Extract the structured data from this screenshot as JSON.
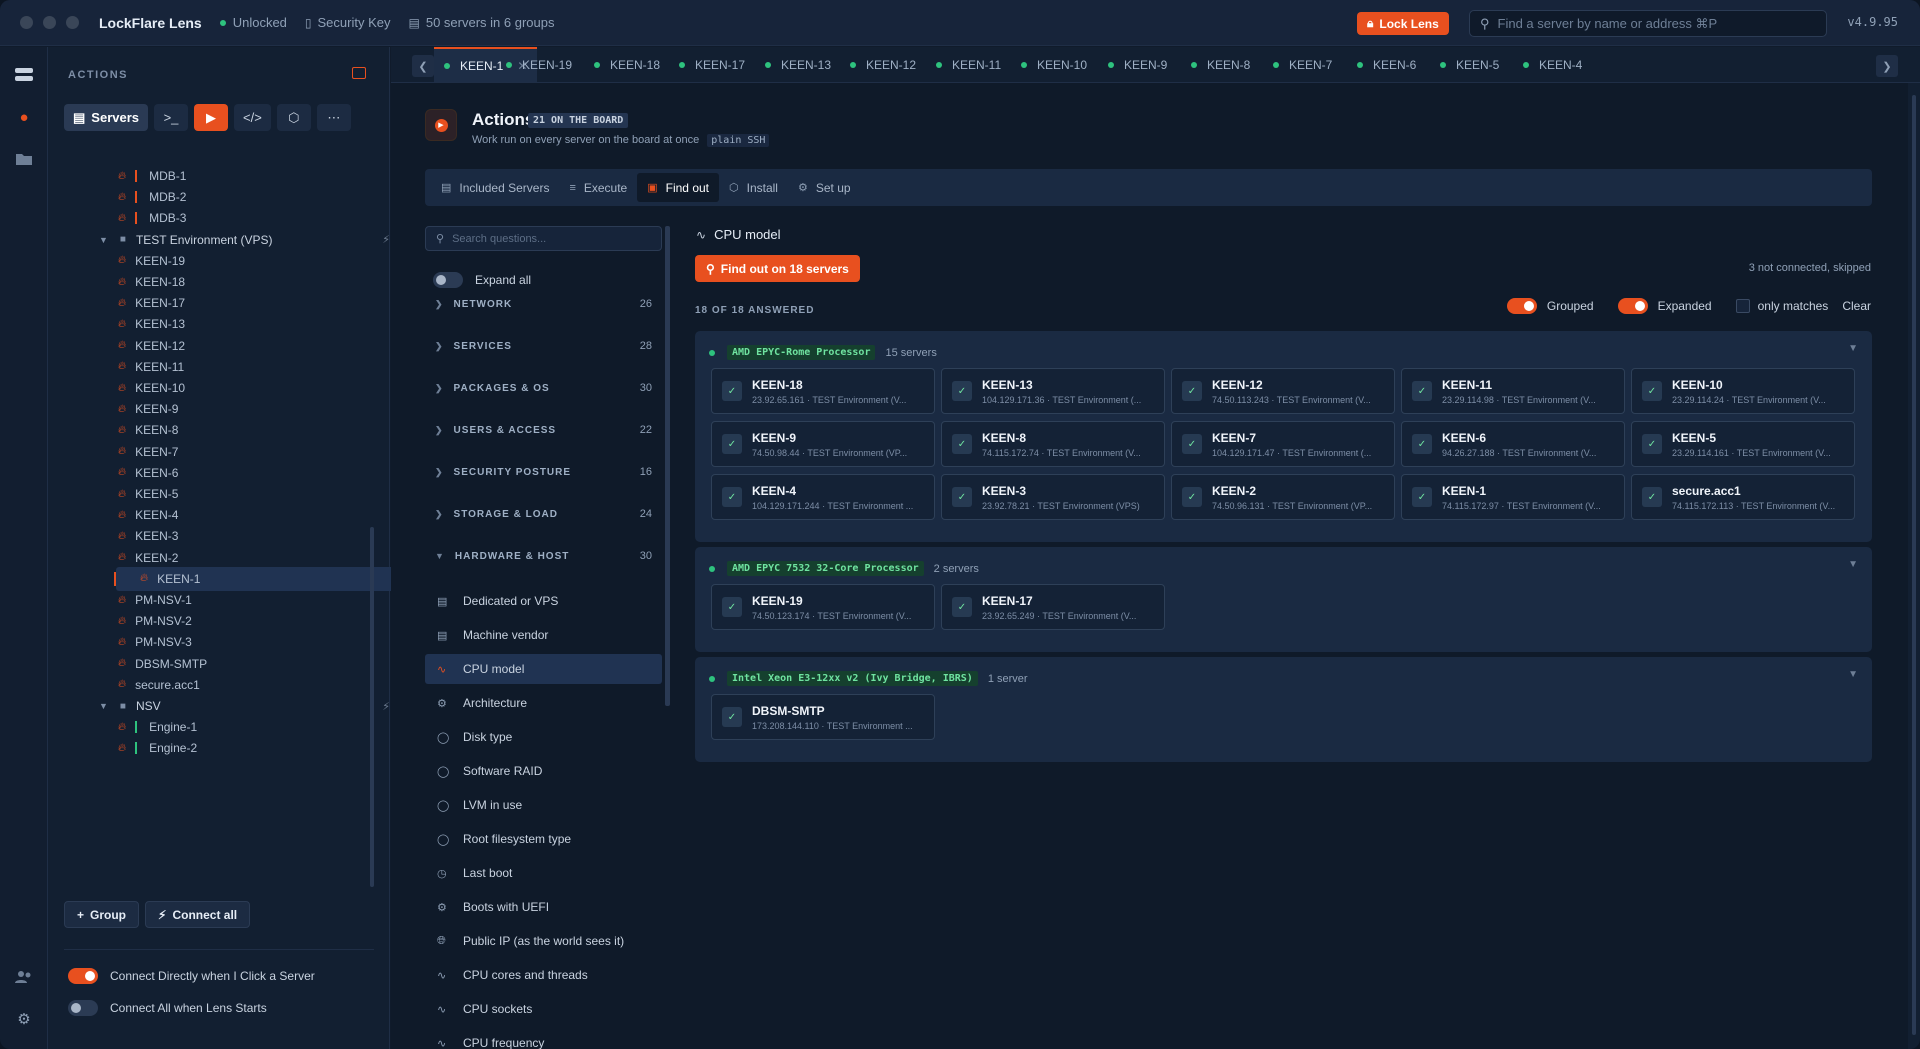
{
  "app": {
    "name": "LockFlare Lens",
    "status": "Unlocked",
    "security_key": "Security Key",
    "servers_summary": "50 servers in 6 groups",
    "lock_button": "Lock Lens",
    "search_placeholder": "Find a server by name or address  ⌘P",
    "version": "v4.9.95"
  },
  "sidebar": {
    "title": "ACTIONS",
    "servers_tab": "Servers",
    "rows": [
      {
        "label": "MDB-1",
        "kind": "server",
        "bar": "orange",
        "status": "grey"
      },
      {
        "label": "MDB-2",
        "kind": "server",
        "bar": "orange",
        "status": "grey"
      },
      {
        "label": "MDB-3",
        "kind": "server",
        "bar": "orange",
        "status": "grey"
      },
      {
        "label": "TEST Environment (VPS)",
        "kind": "group"
      },
      {
        "label": "KEEN-19",
        "kind": "server",
        "status": "green"
      },
      {
        "label": "KEEN-18",
        "kind": "server",
        "status": "green"
      },
      {
        "label": "KEEN-17",
        "kind": "server",
        "status": "green"
      },
      {
        "label": "KEEN-13",
        "kind": "server",
        "status": "green"
      },
      {
        "label": "KEEN-12",
        "kind": "server",
        "status": "green"
      },
      {
        "label": "KEEN-11",
        "kind": "server",
        "status": "green"
      },
      {
        "label": "KEEN-10",
        "kind": "server",
        "status": "green"
      },
      {
        "label": "KEEN-9",
        "kind": "server",
        "status": "green"
      },
      {
        "label": "KEEN-8",
        "kind": "server",
        "status": "green"
      },
      {
        "label": "KEEN-7",
        "kind": "server",
        "status": "green"
      },
      {
        "label": "KEEN-6",
        "kind": "server",
        "status": "green"
      },
      {
        "label": "KEEN-5",
        "kind": "server",
        "status": "green"
      },
      {
        "label": "KEEN-4",
        "kind": "server",
        "status": "green"
      },
      {
        "label": "KEEN-3",
        "kind": "server",
        "status": "green"
      },
      {
        "label": "KEEN-2",
        "kind": "server",
        "status": "green"
      },
      {
        "label": "KEEN-1",
        "kind": "server",
        "status": "green",
        "selected": true
      },
      {
        "label": "PM-NSV-1",
        "kind": "server",
        "status": "grey"
      },
      {
        "label": "PM-NSV-2",
        "kind": "server",
        "status": "grey"
      },
      {
        "label": "PM-NSV-3",
        "kind": "server",
        "status": "grey"
      },
      {
        "label": "DBSM-SMTP",
        "kind": "server",
        "status": "green"
      },
      {
        "label": "secure.acc1",
        "kind": "server",
        "status": "grey"
      },
      {
        "label": "NSV",
        "kind": "group"
      },
      {
        "label": "Engine-1",
        "kind": "server",
        "bar": "green",
        "status": "grey"
      },
      {
        "label": "Engine-2",
        "kind": "server",
        "bar": "green",
        "status": "grey"
      }
    ],
    "group_button": "Group",
    "connect_all_button": "Connect all",
    "toggle_connect_direct": "Connect Directly when I Click a Server",
    "toggle_connect_all": "Connect All when Lens Starts"
  },
  "tabs": [
    "KEEN-1",
    "KEEN-19",
    "KEEN-18",
    "KEEN-17",
    "KEEN-13",
    "KEEN-12",
    "KEEN-11",
    "KEEN-10",
    "KEEN-9",
    "KEEN-8",
    "KEEN-7",
    "KEEN-6",
    "KEEN-5",
    "KEEN-4"
  ],
  "header": {
    "title": "Actions",
    "badge": "21 ON THE BOARD",
    "subtitle": "Work run on every server on the board at once",
    "mode": "plain SSH"
  },
  "subtabs": [
    {
      "label": "Included Servers",
      "icon": "servers-icon"
    },
    {
      "label": "Execute",
      "icon": "sliders-icon"
    },
    {
      "label": "Find out",
      "icon": "document-search-icon"
    },
    {
      "label": "Install",
      "icon": "package-icon"
    },
    {
      "label": "Set up",
      "icon": "gear-icon"
    }
  ],
  "questions": {
    "search_placeholder": "Search questions...",
    "expand_all": "Expand all",
    "categories": [
      {
        "label": "NETWORK",
        "count": "26"
      },
      {
        "label": "SERVICES",
        "count": "28"
      },
      {
        "label": "PACKAGES & OS",
        "count": "30"
      },
      {
        "label": "USERS & ACCESS",
        "count": "22"
      },
      {
        "label": "SECURITY POSTURE",
        "count": "16"
      },
      {
        "label": "STORAGE & LOAD",
        "count": "24"
      },
      {
        "label": "HARDWARE & HOST",
        "count": "30"
      }
    ],
    "items": [
      {
        "label": "Dedicated or VPS",
        "icon": "server-icon"
      },
      {
        "label": "Machine vendor",
        "icon": "server-icon"
      },
      {
        "label": "CPU model",
        "icon": "pulse-icon",
        "active": true
      },
      {
        "label": "Architecture",
        "icon": "gear-icon"
      },
      {
        "label": "Disk type",
        "icon": "database-icon"
      },
      {
        "label": "Software RAID",
        "icon": "database-icon"
      },
      {
        "label": "LVM in use",
        "icon": "database-icon"
      },
      {
        "label": "Root filesystem type",
        "icon": "database-icon"
      },
      {
        "label": "Last boot",
        "icon": "clock-icon"
      },
      {
        "label": "Boots with UEFI",
        "icon": "gear-icon"
      },
      {
        "label": "Public IP (as the world sees it)",
        "icon": "globe-icon"
      },
      {
        "label": "CPU cores and threads",
        "icon": "pulse-icon"
      },
      {
        "label": "CPU sockets",
        "icon": "pulse-icon"
      },
      {
        "label": "CPU frequency",
        "icon": "pulse-icon"
      }
    ]
  },
  "results": {
    "title": "CPU model",
    "find_button": "Find out on 18 servers",
    "skipped": "3 not connected, skipped",
    "answered": "18 OF 18 ANSWERED",
    "grouped": "Grouped",
    "expanded": "Expanded",
    "only_matches": "only matches",
    "clear": "Clear",
    "groups": [
      {
        "tag": "AMD EPYC-Rome Processor",
        "count": "15 servers",
        "servers": [
          {
            "name": "KEEN-18",
            "sub": "23.92.65.161 · TEST Environment (V..."
          },
          {
            "name": "KEEN-13",
            "sub": "104.129.171.36 · TEST Environment (..."
          },
          {
            "name": "KEEN-12",
            "sub": "74.50.113.243 · TEST Environment (V..."
          },
          {
            "name": "KEEN-11",
            "sub": "23.29.114.98 · TEST Environment (V..."
          },
          {
            "name": "KEEN-10",
            "sub": "23.29.114.24 · TEST Environment (V..."
          },
          {
            "name": "KEEN-9",
            "sub": "74.50.98.44 · TEST Environment (VP..."
          },
          {
            "name": "KEEN-8",
            "sub": "74.115.172.74 · TEST Environment (V..."
          },
          {
            "name": "KEEN-7",
            "sub": "104.129.171.47 · TEST Environment (..."
          },
          {
            "name": "KEEN-6",
            "sub": "94.26.27.188 · TEST Environment (V..."
          },
          {
            "name": "KEEN-5",
            "sub": "23.29.114.161 · TEST Environment (V..."
          },
          {
            "name": "KEEN-4",
            "sub": "104.129.171.244 · TEST Environment ..."
          },
          {
            "name": "KEEN-3",
            "sub": "23.92.78.21 · TEST Environment (VPS)"
          },
          {
            "name": "KEEN-2",
            "sub": "74.50.96.131 · TEST Environment (VP..."
          },
          {
            "name": "KEEN-1",
            "sub": "74.115.172.97 · TEST Environment (V..."
          },
          {
            "name": "secure.acc1",
            "sub": "74.115.172.113 · TEST Environment (V..."
          }
        ]
      },
      {
        "tag": "AMD EPYC 7532 32-Core Processor",
        "count": "2 servers",
        "servers": [
          {
            "name": "KEEN-19",
            "sub": "74.50.123.174 · TEST Environment (V..."
          },
          {
            "name": "KEEN-17",
            "sub": "23.92.65.249 · TEST Environment (V..."
          }
        ]
      },
      {
        "tag": "Intel Xeon E3-12xx v2 (Ivy Bridge, IBRS)",
        "count": "1 server",
        "servers": [
          {
            "name": "DBSM-SMTP",
            "sub": "173.208.144.110 · TEST Environment ..."
          }
        ]
      }
    ]
  },
  "colors": {
    "accent": "#e8501f",
    "ok": "#2ec27e",
    "bg": "#101b2b",
    "panel": "#1a2a42"
  }
}
